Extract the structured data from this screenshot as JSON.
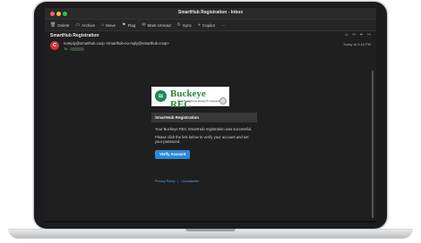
{
  "window": {
    "title": "SmartHub Registration - Inbox"
  },
  "toolbar": {
    "items": [
      {
        "label": "Delete",
        "icon": "trash-icon"
      },
      {
        "label": "Archive",
        "icon": "archive-icon"
      },
      {
        "label": "Move",
        "icon": "folder-move-icon"
      },
      {
        "label": "Flag",
        "icon": "flag-icon"
      },
      {
        "label": "Mark Unread",
        "icon": "envelope-icon"
      },
      {
        "label": "Sync",
        "icon": "sync-icon"
      },
      {
        "label": "Copilot",
        "icon": "copilot-icon"
      },
      {
        "label": "···",
        "icon": "more-icon"
      }
    ]
  },
  "message": {
    "subject": "SmartHub Registration",
    "avatar_letter": "C",
    "sender": "noreply@smarthub.coop <smarthub-no-reply@smarthub.coop>",
    "to_label": "To:",
    "date": "Today at 3:16 PM"
  },
  "email": {
    "logo_text": "Buckeye REC",
    "logo_tagline": "Your Touchstone Energy® Cooperative",
    "header": "SmartHub Registration",
    "line1": "Your Buckeye REC SmartHub registration was successful.",
    "line2": "Please click the link below to verify your account and set your password.",
    "button": "Verify Account",
    "footer_links": [
      "Privacy Policy",
      "Unsubscribe"
    ],
    "footer_separator": "|"
  },
  "colors": {
    "accent": "#2b88d8",
    "avatar": "#d13438",
    "brand_green": "#2a8a3c"
  }
}
